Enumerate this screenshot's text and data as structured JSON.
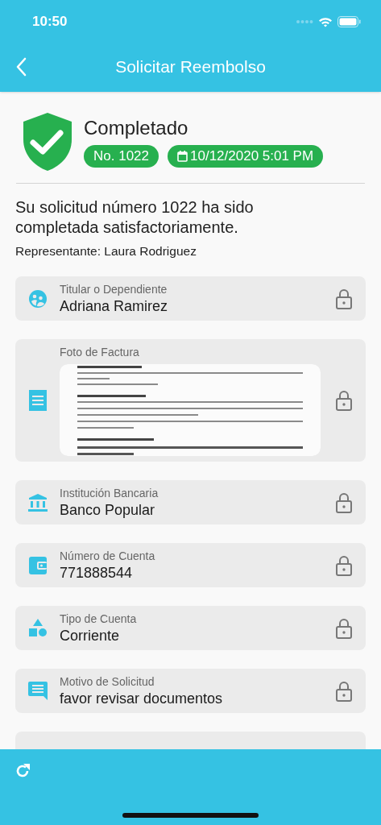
{
  "status_bar": {
    "time": "10:50"
  },
  "app_bar": {
    "title": "Solicitar Reembolso"
  },
  "status": {
    "title": "Completado",
    "number_badge": "No. 1022",
    "date_badge": "10/12/2020 5:01 PM"
  },
  "message": "Su solicitud número 1022 ha sido completada satisfactoriamente.",
  "representative": "Representante: Laura Rodriguez",
  "fields": [
    {
      "kind": "text",
      "label": "Titular o Dependiente",
      "value": "Adriana Ramirez",
      "locked": true
    },
    {
      "label": "Foto de Factura",
      "locked": true
    },
    {
      "kind": "text",
      "label": "Institución Bancaria",
      "value": "Banco Popular",
      "locked": true
    },
    {
      "kind": "text",
      "label": "Número de Cuenta",
      "value": "771888544",
      "locked": true
    },
    {
      "kind": "text",
      "label": "Tipo de Cuenta",
      "value": "Corriente",
      "locked": true
    },
    {
      "kind": "text",
      "label": "Motivo de Solicitud",
      "value": "favor revisar documentos",
      "locked": true
    }
  ]
}
